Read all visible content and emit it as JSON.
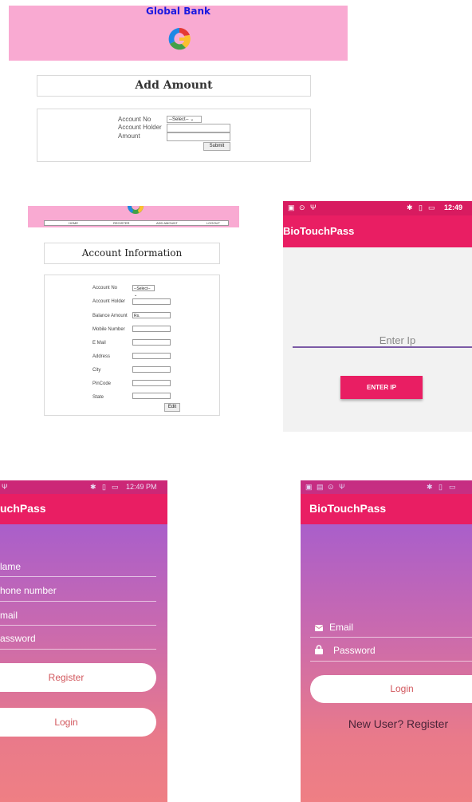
{
  "bank": {
    "title": "Global Bank",
    "add_amount": {
      "heading": "Add Amount",
      "account_no_label": "Account No",
      "account_no_value": "--Select-- ⌄",
      "holder_label": "Account Holder",
      "amount_label": "Amount",
      "submit_label": "Submit"
    },
    "nav": [
      "HOME",
      "REGISTER",
      "ADD AMOUNT",
      "LOGOUT"
    ],
    "account_info": {
      "heading": "Account Information",
      "fields": [
        {
          "label": "Account No",
          "value": "--Select-- ⌄"
        },
        {
          "label": "Account Holder",
          "value": ""
        },
        {
          "label": "Balance Amount",
          "value": "Rs."
        },
        {
          "label": "Mobile Number",
          "value": ""
        },
        {
          "label": "E Mail",
          "value": ""
        },
        {
          "label": "Address",
          "value": ""
        },
        {
          "label": "City",
          "value": ""
        },
        {
          "label": "PinCode",
          "value": ""
        },
        {
          "label": "State",
          "value": ""
        }
      ],
      "edit_label": "Edit"
    }
  },
  "phone_ip": {
    "time": "12:49",
    "app_title": "BioTouchPass",
    "ip_placeholder": "Enter Ip",
    "enter_ip_button": "ENTER IP"
  },
  "phone_register": {
    "time": "12:49 PM",
    "app_title": "uchPass",
    "name_placeholder": "lame",
    "phone_placeholder": "hone number",
    "email_placeholder": "mail",
    "password_placeholder": "assword",
    "register_button": "Register",
    "login_button": "Login"
  },
  "phone_login": {
    "app_title": "BioTouchPass",
    "email_placeholder": "Email",
    "password_placeholder": "Password",
    "login_button": "Login",
    "register_link": "New User? Register"
  },
  "colors": {
    "bank_pink": "#f9aad2",
    "app_bar": "#e91e63",
    "status_bar": "#d81b60",
    "gradient_top": "#9c5ad6",
    "gradient_bottom": "#ef7f84"
  }
}
